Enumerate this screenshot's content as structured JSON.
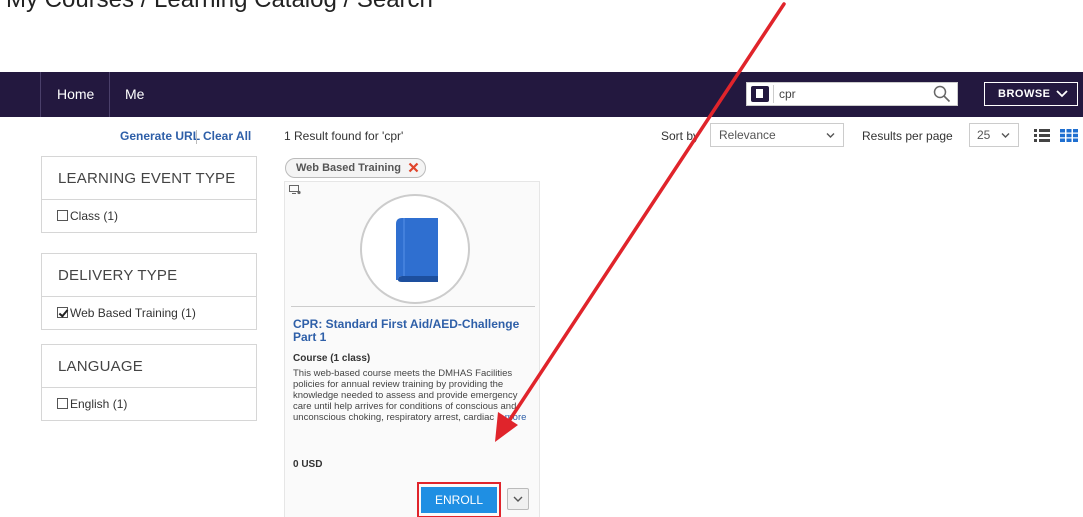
{
  "caption": {
    "text": "My Courses / Learning Catalog / Search"
  },
  "nav": {
    "home": "Home",
    "me": "Me",
    "browse": "BROWSE"
  },
  "search": {
    "value": "cpr",
    "placeholder": ""
  },
  "filters": {
    "generate_url": "Generate URL",
    "clear_all": "Clear All",
    "results_found": "1 Result found for 'cpr'",
    "facets": [
      {
        "title": "LEARNING EVENT TYPE",
        "options": [
          {
            "label": "Class (1)",
            "checked": false
          }
        ]
      },
      {
        "title": "DELIVERY TYPE",
        "options": [
          {
            "label": "Web Based Training (1)",
            "checked": true
          }
        ]
      },
      {
        "title": "LANGUAGE",
        "options": [
          {
            "label": "English (1)",
            "checked": false
          }
        ]
      }
    ]
  },
  "chip": {
    "label": "Web Based Training"
  },
  "card": {
    "title": "CPR: Standard First Aid/AED-Challenge Part 1",
    "subtitle": "Course (1 class)",
    "description": "This web-based course meets the DMHAS Facilities policies for annual review training by providing the knowledge needed to assess and provide emergency care until help arrives for conditions of conscious and unconscious choking, respiratory arrest, cardiac",
    "more": "...more",
    "price": "0 USD",
    "enroll": "ENROLL"
  },
  "sort": {
    "label": "Sort by",
    "value": "Relevance"
  },
  "rpp": {
    "label": "Results per page",
    "value": "25"
  },
  "colors": {
    "nav_bg": "#23183f",
    "link": "#2e5fa8",
    "enroll_bg": "#1f8fe3",
    "highlight": "#e0242b",
    "book": "#2f6fd0"
  }
}
